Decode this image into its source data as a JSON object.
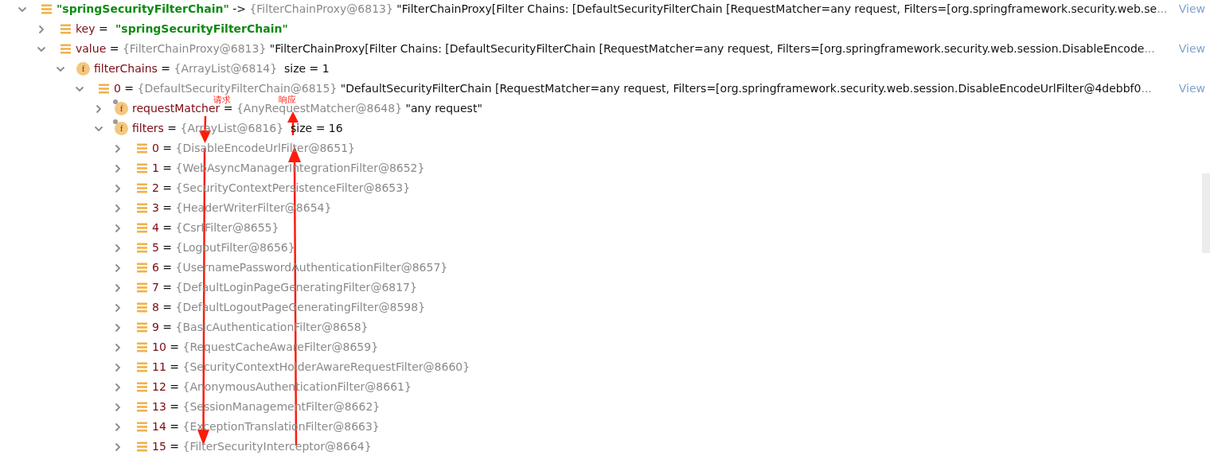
{
  "tree": [
    {
      "kind": "keyed_entry",
      "name": "\"springSecurityFilterChain\"",
      "sep": " -> ",
      "ref": "{FilterChainProxy@6813}",
      "value": "\"FilterChainProxy[Filter Chains: [DefaultSecurityFilterChain [RequestMatcher=any request, Filters=[org.springframework.security.web.se",
      "more": "...",
      "link": "View",
      "expanded": true,
      "children": [
        {
          "kind": "string_entry",
          "name": "key",
          "sep": " = ",
          "value": "\"springSecurityFilterChain\"",
          "expanded": false
        },
        {
          "kind": "entry",
          "name": "value",
          "sep": " = ",
          "ref": "{FilterChainProxy@6813}",
          "value": "\"FilterChainProxy[Filter Chains: [DefaultSecurityFilterChain [RequestMatcher=any request, Filters=[org.springframework.security.web.session.DisableEncode",
          "more": "...",
          "link": "View",
          "expanded": true,
          "children": [
            {
              "kind": "field",
              "badge": "f",
              "pinned": false,
              "name": "filterChains",
              "sep": " = ",
              "ref": "{ArrayList@6814}",
              "size": "size = 1",
              "expanded": true,
              "children": [
                {
                  "kind": "entry",
                  "name": "0",
                  "sep": " = ",
                  "ref": "{DefaultSecurityFilterChain@6815}",
                  "value": "\"DefaultSecurityFilterChain [RequestMatcher=any request, Filters=[org.springframework.security.web.session.DisableEncodeUrlFilter@4debbf0",
                  "more": "...",
                  "link": "View",
                  "expanded": true,
                  "children": [
                    {
                      "kind": "field",
                      "badge": "f",
                      "pinned": true,
                      "name": "requestMatcher",
                      "sep": " = ",
                      "ref": "{AnyRequestMatcher@8648}",
                      "value": "\"any request\"",
                      "expanded": false
                    },
                    {
                      "kind": "field",
                      "badge": "f",
                      "pinned": true,
                      "name": "filters",
                      "sep": " = ",
                      "ref": "{ArrayList@6816}",
                      "size": "size = 16",
                      "expanded": true,
                      "children": [
                        {
                          "kind": "entry",
                          "name": "0",
                          "sep": " = ",
                          "ref": "{DisableEncodeUrlFilter@8651}",
                          "expanded": false
                        },
                        {
                          "kind": "entry",
                          "name": "1",
                          "sep": " = ",
                          "ref": "{WebAsyncManagerIntegrationFilter@8652}",
                          "expanded": false
                        },
                        {
                          "kind": "entry",
                          "name": "2",
                          "sep": " = ",
                          "ref": "{SecurityContextPersistenceFilter@8653}",
                          "expanded": false
                        },
                        {
                          "kind": "entry",
                          "name": "3",
                          "sep": " = ",
                          "ref": "{HeaderWriterFilter@8654}",
                          "expanded": false
                        },
                        {
                          "kind": "entry",
                          "name": "4",
                          "sep": " = ",
                          "ref": "{CsrfFilter@8655}",
                          "expanded": false
                        },
                        {
                          "kind": "entry",
                          "name": "5",
                          "sep": " = ",
                          "ref": "{LogoutFilter@8656}",
                          "expanded": false
                        },
                        {
                          "kind": "entry",
                          "name": "6",
                          "sep": " = ",
                          "ref": "{UsernamePasswordAuthenticationFilter@8657}",
                          "expanded": false
                        },
                        {
                          "kind": "entry",
                          "name": "7",
                          "sep": " = ",
                          "ref": "{DefaultLoginPageGeneratingFilter@6817}",
                          "expanded": false
                        },
                        {
                          "kind": "entry",
                          "name": "8",
                          "sep": " = ",
                          "ref": "{DefaultLogoutPageGeneratingFilter@8598}",
                          "expanded": false
                        },
                        {
                          "kind": "entry",
                          "name": "9",
                          "sep": " = ",
                          "ref": "{BasicAuthenticationFilter@8658}",
                          "expanded": false
                        },
                        {
                          "kind": "entry",
                          "name": "10",
                          "sep": " = ",
                          "ref": "{RequestCacheAwareFilter@8659}",
                          "expanded": false
                        },
                        {
                          "kind": "entry",
                          "name": "11",
                          "sep": " = ",
                          "ref": "{SecurityContextHolderAwareRequestFilter@8660}",
                          "expanded": false
                        },
                        {
                          "kind": "entry",
                          "name": "12",
                          "sep": " = ",
                          "ref": "{AnonymousAuthenticationFilter@8661}",
                          "expanded": false
                        },
                        {
                          "kind": "entry",
                          "name": "13",
                          "sep": " = ",
                          "ref": "{SessionManagementFilter@8662}",
                          "expanded": false
                        },
                        {
                          "kind": "entry",
                          "name": "14",
                          "sep": " = ",
                          "ref": "{ExceptionTranslationFilter@8663}",
                          "expanded": false
                        },
                        {
                          "kind": "entry",
                          "name": "15",
                          "sep": " = ",
                          "ref": "{FilterSecurityInterceptor@8664}",
                          "expanded": false
                        }
                      ]
                    }
                  ]
                }
              ]
            }
          ]
        }
      ]
    }
  ],
  "annotations": [
    {
      "label": "请求",
      "kind": "down"
    },
    {
      "label": "响应",
      "kind": "up"
    }
  ]
}
